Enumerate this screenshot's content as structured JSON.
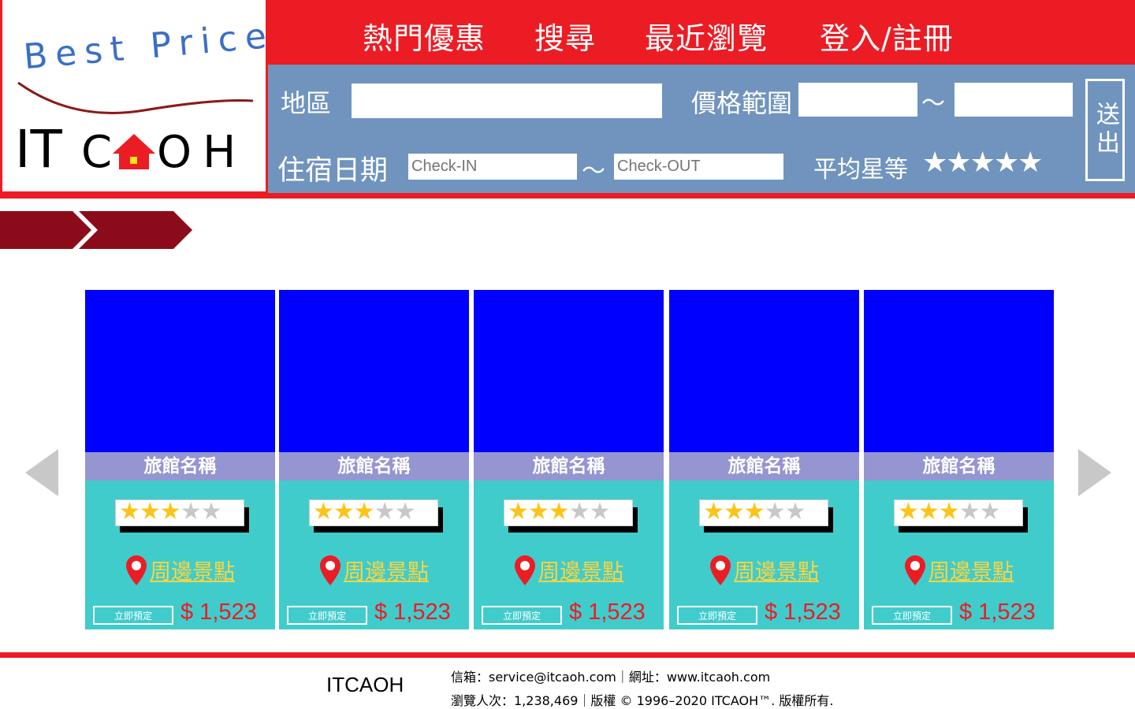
{
  "logo": {
    "tagline": "Best Price",
    "brand_left": "IT",
    "brand_c": "C",
    "brand_right": "OH"
  },
  "nav": {
    "items": [
      "熱門優惠",
      "搜尋",
      "最近瀏覽",
      "登入/註冊"
    ]
  },
  "search": {
    "region_label": "地區",
    "price_label": "價格範圍",
    "price_separator": "〜",
    "date_label": "住宿日期",
    "checkin_placeholder": "Check-IN",
    "checkout_placeholder": "Check-OUT",
    "date_separator": "〜",
    "rating_label": "平均星等",
    "rating_stars": "★★★★★",
    "submit_label": "送出"
  },
  "cards": [
    {
      "name": "旅館名稱",
      "stars_on": "★★★",
      "stars_off": "★★",
      "nearby": "周邊景點",
      "book": "立即預定",
      "price": "$ 1,523"
    },
    {
      "name": "旅館名稱",
      "stars_on": "★★★",
      "stars_off": "★★",
      "nearby": "周邊景點",
      "book": "立即預定",
      "price": "$ 1,523"
    },
    {
      "name": "旅館名稱",
      "stars_on": "★★★",
      "stars_off": "★★",
      "nearby": "周邊景點",
      "book": "立即預定",
      "price": "$ 1,523"
    },
    {
      "name": "旅館名稱",
      "stars_on": "★★★",
      "stars_off": "★★",
      "nearby": "周邊景點",
      "book": "立即預定",
      "price": "$ 1,523"
    },
    {
      "name": "旅館名稱",
      "stars_on": "★★★",
      "stars_off": "★★",
      "nearby": "周邊景點",
      "book": "立即預定",
      "price": "$ 1,523"
    }
  ],
  "footer": {
    "brand": "ITCAOH",
    "line1": "信箱：service@itcaoh.com｜網址：www.itcaoh.com",
    "line2": "瀏覽人次：1,238,469｜版權 © 1996–2020 ITCAOH™. 版權所有."
  },
  "colors": {
    "red": "#ec1c24",
    "panel": "#7094be",
    "card_image": "#0000ff",
    "card_name": "#9595d2",
    "card_body": "#41cccc",
    "star": "#fcc419"
  },
  "icons": [
    "location-pin-icon",
    "chevron-left-icon",
    "chevron-right-icon",
    "house-icon"
  ]
}
